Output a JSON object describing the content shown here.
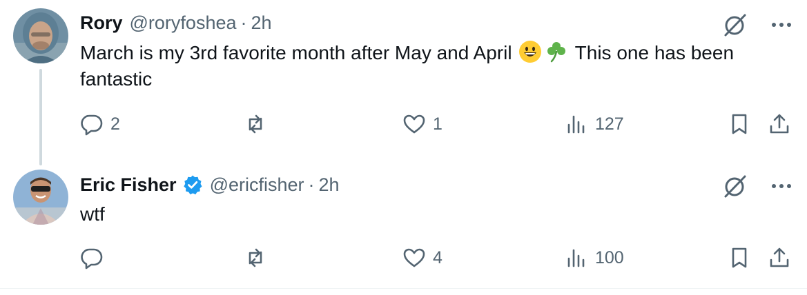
{
  "tweets": [
    {
      "name": "Rory",
      "handle": "@roryfoshea",
      "separator": "·",
      "time": "2h",
      "text_before": "March is my 3rd favorite month after May and April",
      "text_after": "This one has been fantastic",
      "emojis": [
        "grinning-face-emoji",
        "shamrock-emoji"
      ],
      "verified": false,
      "replies": "2",
      "retweets": "",
      "likes": "1",
      "views": "127"
    },
    {
      "name": "Eric Fisher",
      "handle": "@ericfisher",
      "separator": "·",
      "time": "2h",
      "text": "wtf",
      "verified": true,
      "replies": "",
      "retweets": "",
      "likes": "4",
      "views": "100"
    }
  ],
  "colors": {
    "text": "#0f1419",
    "secondary": "#536471",
    "verified": "#1d9bf0",
    "thread_line": "#cfd9de"
  },
  "icons": [
    "grok-icon",
    "more-icon",
    "reply-icon",
    "retweet-icon",
    "like-icon",
    "views-icon",
    "bookmark-icon",
    "share-icon"
  ]
}
